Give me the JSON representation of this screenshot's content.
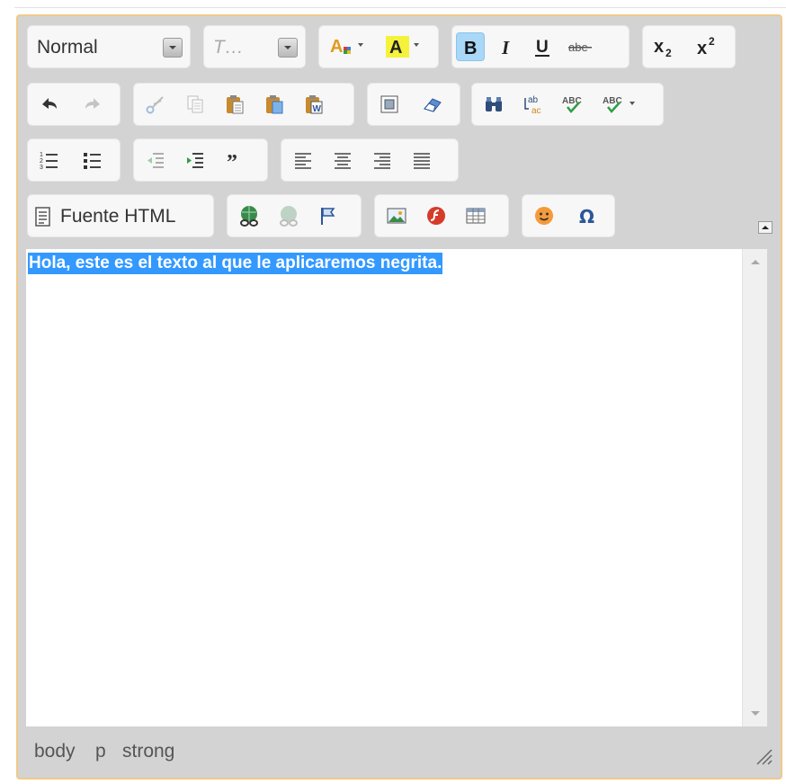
{
  "toolbar": {
    "format_combo": {
      "value": "Normal"
    },
    "font_combo": {
      "value": "T…"
    },
    "source_button": {
      "label": "Fuente HTML"
    }
  },
  "editor": {
    "content_text": "Hola, este es el texto al que le aplicaremos negrita."
  },
  "elements_path": [
    "body",
    "p",
    "strong"
  ],
  "colors": {
    "border_accent": "#f0c98a",
    "selection": "#3399ff",
    "active_button": "#a9d8f7"
  }
}
